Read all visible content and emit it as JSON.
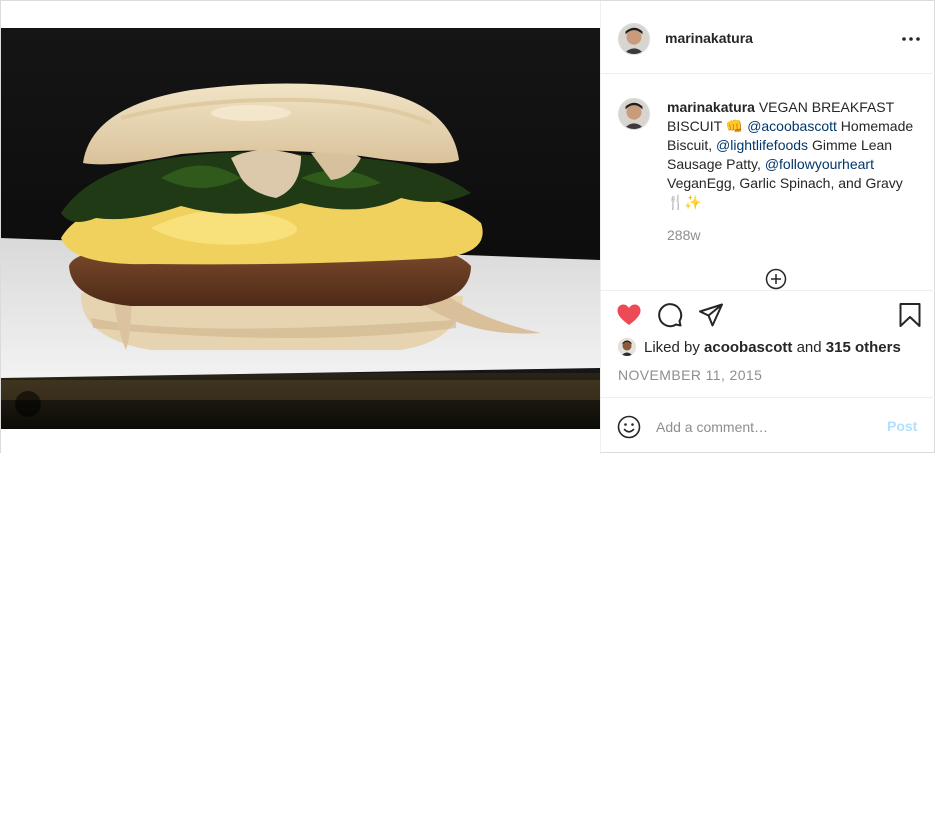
{
  "post": {
    "image_alt": "Vegan breakfast biscuit sandwich",
    "tagged_user_icon": "person-icon"
  },
  "header": {
    "username": "marinakatura",
    "more_icon": "more-horizontal-icon"
  },
  "caption": {
    "username": "marinakatura",
    "text_1": " VEGAN BREAKFAST BISCUIT 👊 ",
    "mention_1": "@acoobascott",
    "text_2": " Homemade Biscuit, ",
    "mention_2": "@lightlifefoods",
    "text_3": " Gimme Lean Sausage Patty, ",
    "mention_3": "@followyourheart",
    "text_4": " VeganEgg, Garlic Spinach, and Gravy 🍴✨",
    "age": "288w",
    "load_more_icon": "plus-circle-icon"
  },
  "actions": {
    "like_icon": "heart-filled-icon",
    "comment_icon": "speech-bubble-icon",
    "share_icon": "paper-plane-icon",
    "save_icon": "bookmark-icon",
    "liked_by_prefix": "Liked by ",
    "liked_by_user": "acoobascott",
    "liked_by_and": " and ",
    "liked_by_others": "315 others",
    "date": "NOVEMBER 11, 2015",
    "colors": {
      "heart": "#ed4956",
      "mention": "#00376b",
      "muted": "#8e8e8e",
      "post_disabled": "#b2dffc"
    }
  },
  "add_comment": {
    "emoji_icon": "smiley-icon",
    "placeholder": "Add a comment…",
    "post_label": "Post"
  }
}
